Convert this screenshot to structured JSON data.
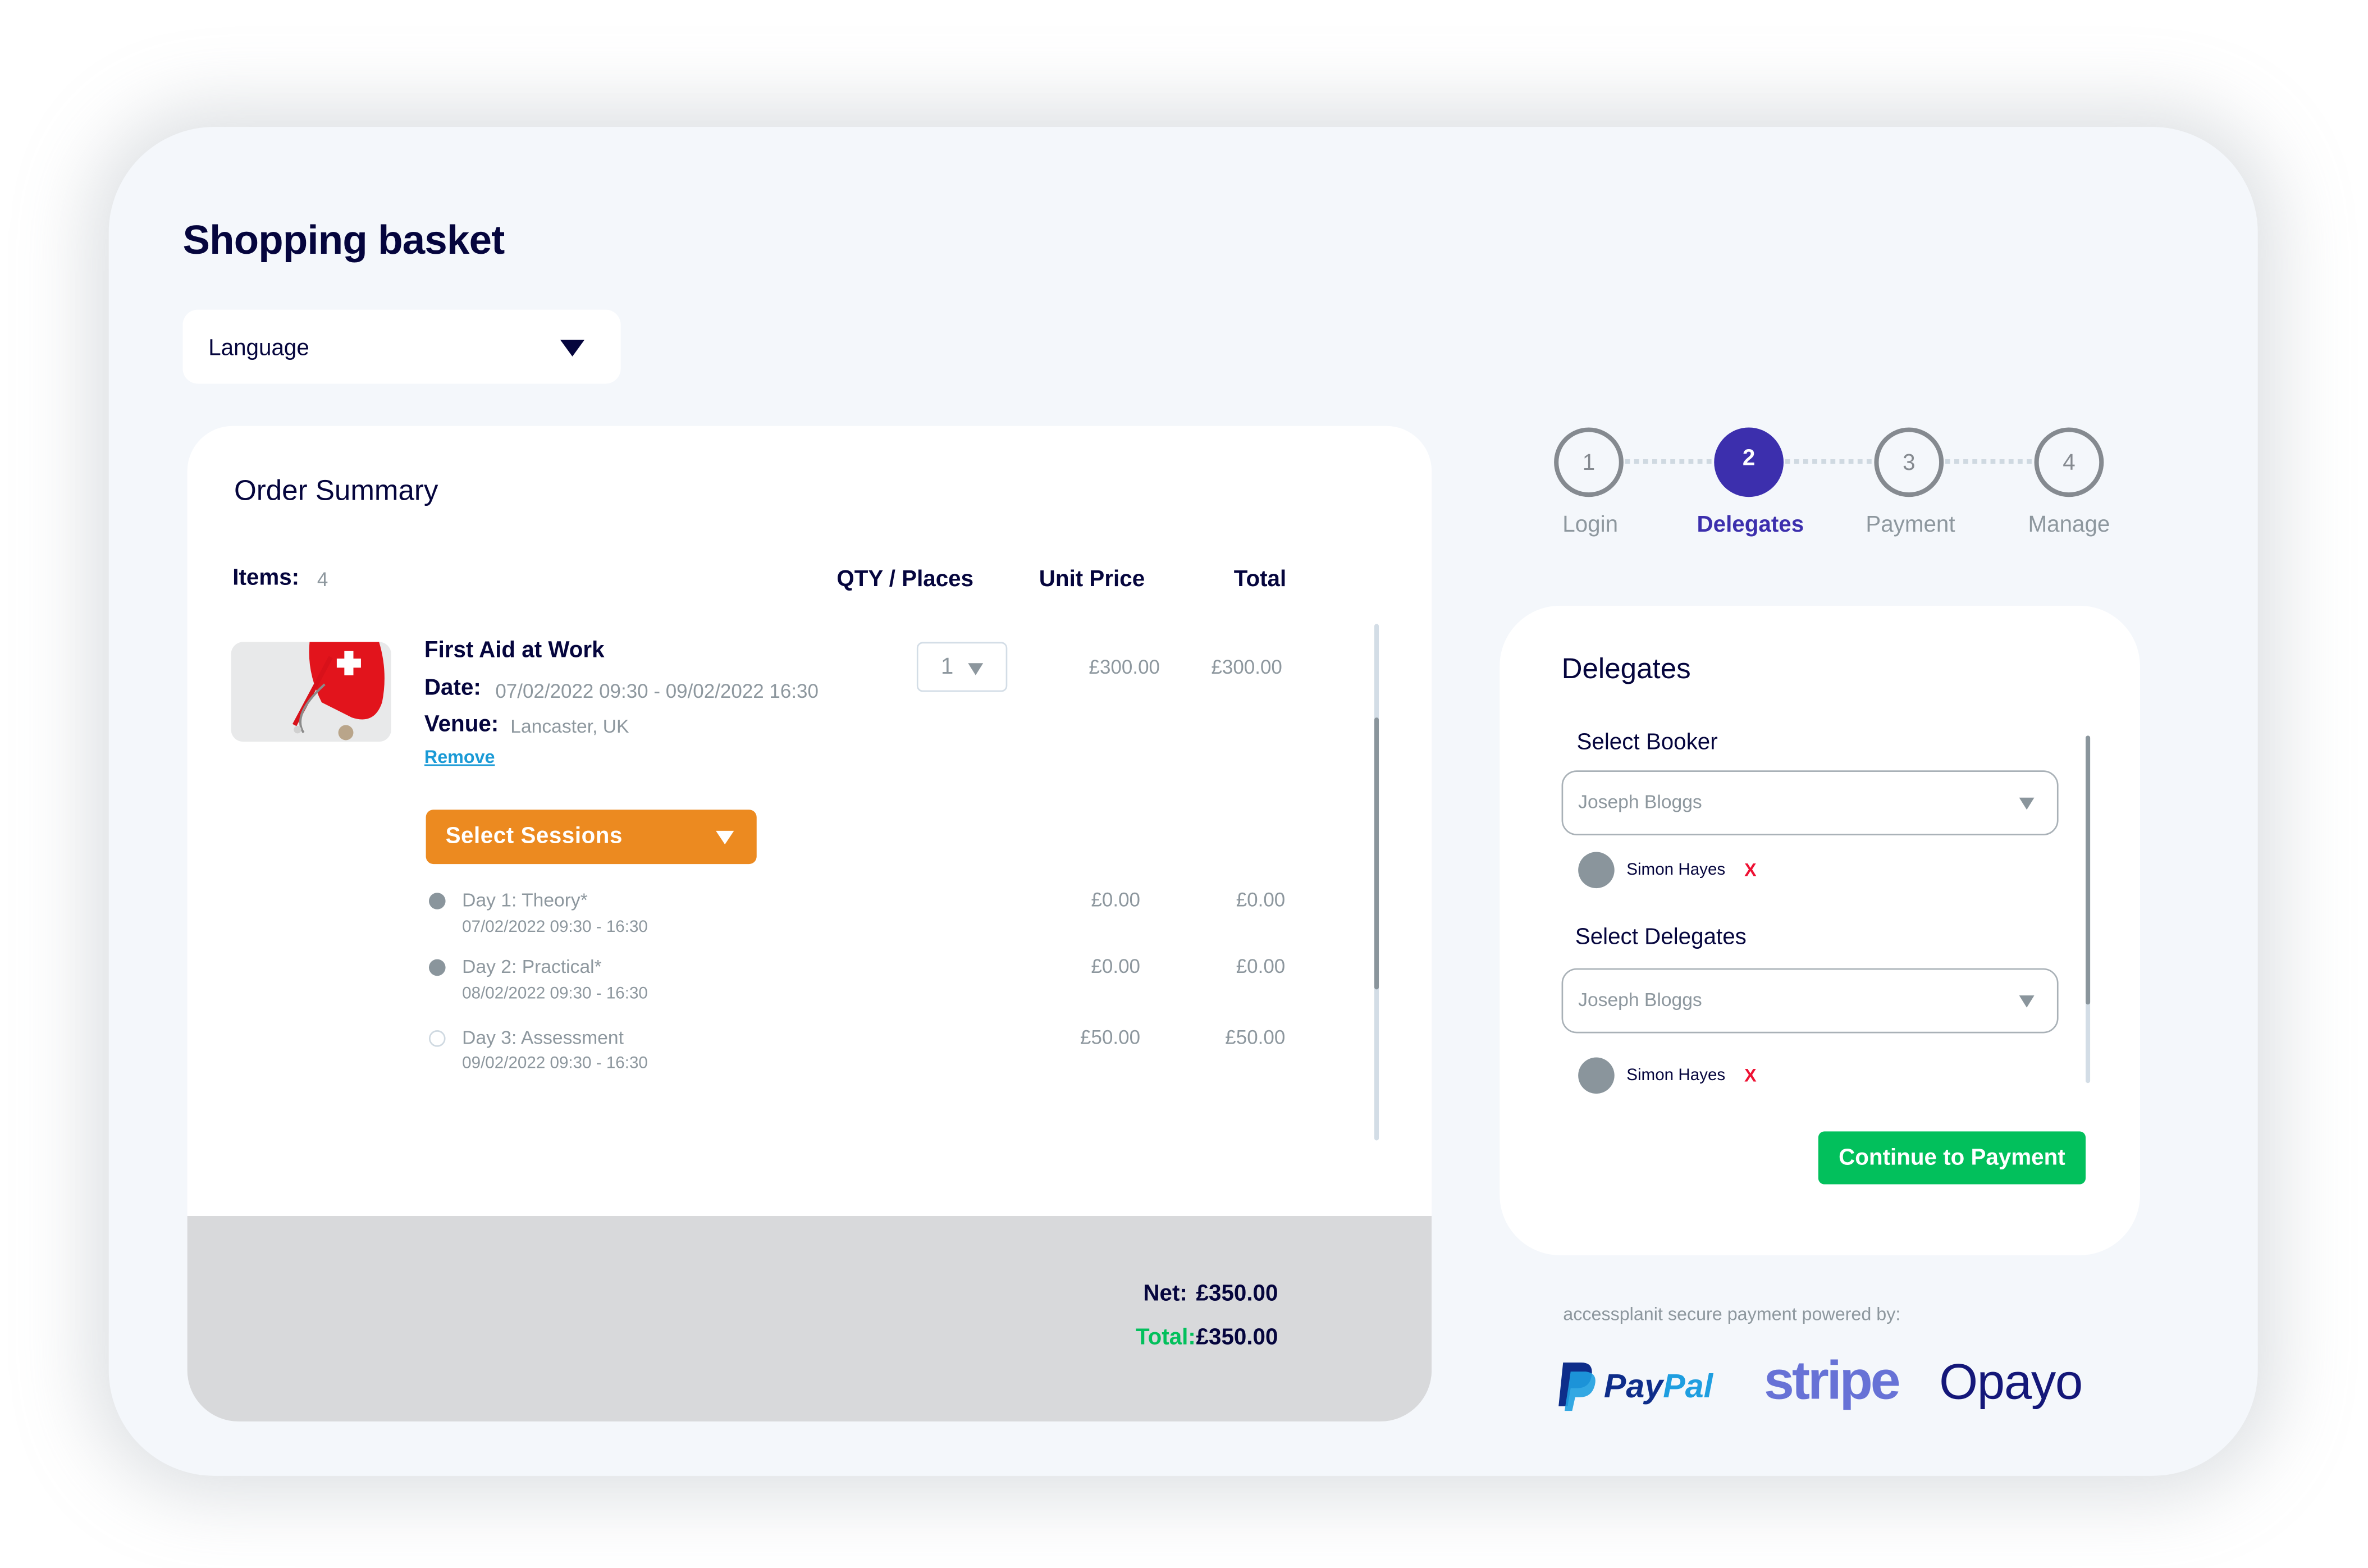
{
  "page": {
    "title": "Shopping basket",
    "language_select": {
      "label": "Language"
    }
  },
  "order_summary": {
    "title": "Order Summary",
    "items_label": "Items:",
    "items_count": "4",
    "columns": {
      "qty": "QTY / Places",
      "unit_price": "Unit Price",
      "total": "Total"
    },
    "item": {
      "name": "First Aid at Work",
      "date_label": "Date:",
      "date_value": "07/02/2022 09:30  -  09/02/2022 16:30",
      "venue_label": "Venue:",
      "venue_value": "Lancaster, UK",
      "remove_label": "Remove",
      "qty": "1",
      "unit_price": "£300.00",
      "total": "£300.00",
      "image_alt": "first-aid-kit-with-stethoscope"
    },
    "sessions_button": "Select  Sessions",
    "sessions": [
      {
        "name": "Day 1: Theory*",
        "date": "07/02/2022  09:30 - 16:30",
        "selected": true,
        "unit_price": "£0.00",
        "total": "£0.00"
      },
      {
        "name": "Day 2: Practical*",
        "date": "08/02/2022  09:30 - 16:30",
        "selected": true,
        "unit_price": "£0.00",
        "total": "£0.00"
      },
      {
        "name": "Day 3: Assessment",
        "date": "09/02/2022  09:30 - 16:30",
        "selected": false,
        "unit_price": "£50.00",
        "total": "£50.00"
      }
    ],
    "net_label": "Net:",
    "net_value": "£350.00",
    "total_label": "Total:",
    "total_value": "£350.00"
  },
  "stepper": {
    "current_step": 2,
    "steps": [
      {
        "number": "1",
        "label": "Login"
      },
      {
        "number": "2",
        "label": "Delegates"
      },
      {
        "number": "3",
        "label": "Payment"
      },
      {
        "number": "4",
        "label": "Manage"
      }
    ]
  },
  "delegates": {
    "title": "Delegates",
    "booker": {
      "label": "Select Booker",
      "placeholder": "Joseph Bloggs",
      "selected_person": "Simon Hayes"
    },
    "delegates_select": {
      "label": "Select Delegates",
      "placeholder": "Joseph Bloggs",
      "selected_person": "Simon Hayes"
    },
    "remove_symbol": "X",
    "continue_button": "Continue to Payment"
  },
  "payment": {
    "powered_by": "accessplanit secure payment powered by:",
    "providers": [
      "PayPal",
      "stripe",
      "Opayo"
    ],
    "paypal_parts": [
      "Pay",
      "Pal"
    ]
  },
  "colors": {
    "primary": "#3c2fad",
    "navy_text": "#05053d",
    "muted_text": "#8d979e",
    "orange": "#ec8a20",
    "green": "#02c05c",
    "remove_red": "#ee1133",
    "link_blue": "#1a9ad6",
    "stripe": "#6772d6",
    "opayo": "#141779",
    "paypal_dark": "#0e2d8a",
    "paypal_light": "#1e9ee0"
  }
}
